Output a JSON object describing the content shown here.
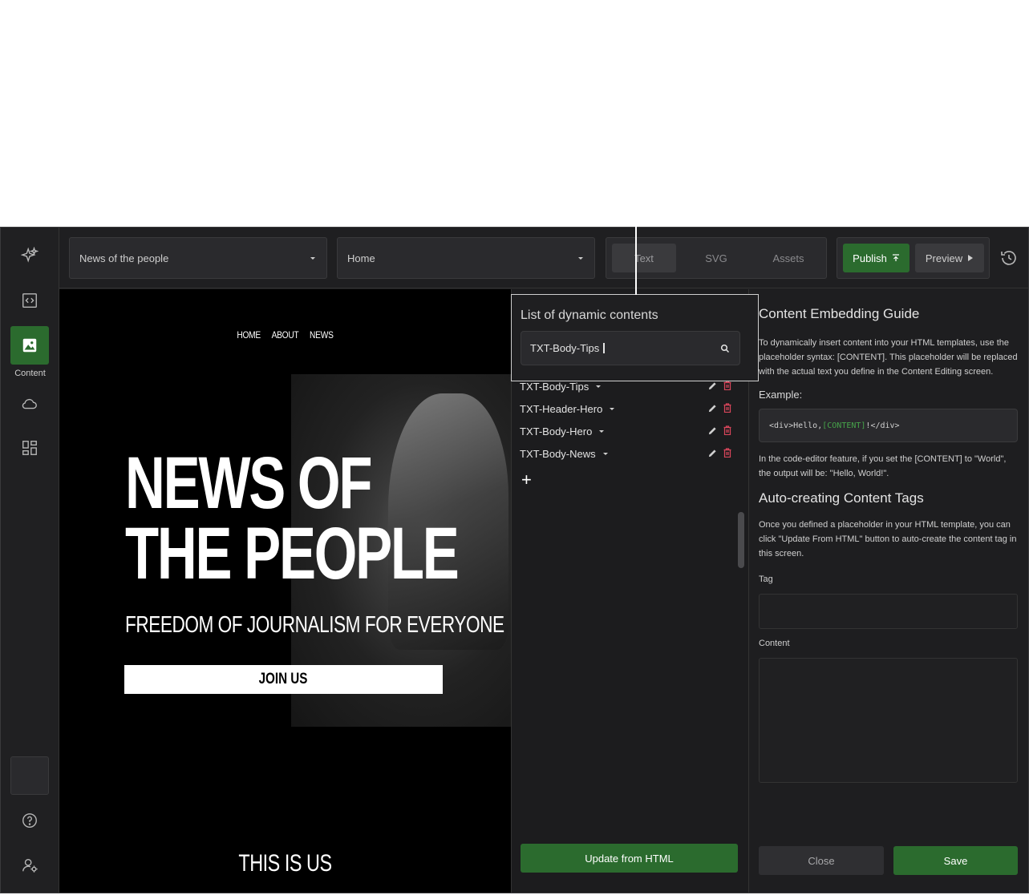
{
  "sidebar": {
    "content_label": "Content"
  },
  "topbar": {
    "site_select": "News of the people",
    "page_select": "Home",
    "tabs": [
      {
        "label": "Text"
      },
      {
        "label": "SVG"
      },
      {
        "label": "Assets"
      }
    ],
    "publish_label": "Publish",
    "preview_label": "Preview"
  },
  "preview": {
    "nav": [
      "HOME",
      "ABOUT",
      "NEWS"
    ],
    "hero_title_line1": "NEWS OF",
    "hero_title_line2": "THE PEOPLE",
    "hero_subtitle": "FREEDOM OF JOURNALISM FOR EVERYONE",
    "join_label": "JOIN US",
    "section_title": "THIS IS US"
  },
  "list": {
    "title": "List of dynamic contents",
    "search_value": "TXT-Body-Tips",
    "items": [
      {
        "label": "TXT-Body-Tips"
      },
      {
        "label": "TXT-Header-Hero"
      },
      {
        "label": "TXT-Body-Hero"
      },
      {
        "label": "TXT-Body-News"
      }
    ],
    "add_label": "+",
    "update_label": "Update from HTML"
  },
  "guide": {
    "title": "Content Embedding Guide",
    "intro": "To dynamically insert content into your HTML templates, use the placeholder syntax: [CONTENT]. This placeholder will be replaced with the actual text you define in the Content Editing screen.",
    "example_label": "Example:",
    "code_before": "<div>Hello, ",
    "code_highlight": "[CONTENT]",
    "code_after": "!</div>",
    "result_text": "In the code-editor feature, if you set the [CONTENT] to \"World\", the output will be: \"Hello, World!\".",
    "auto_title": "Auto-creating Content Tags",
    "auto_text": "Once you defined a placeholder in your HTML template, you can click \"Update From HTML\" button to auto-create the content tag in this screen.",
    "tag_label": "Tag",
    "content_label": "Content",
    "close_label": "Close",
    "save_label": "Save"
  },
  "colors": {
    "accent": "#2b6b2e",
    "background": "#1e1e20",
    "delete": "#d9465b"
  }
}
